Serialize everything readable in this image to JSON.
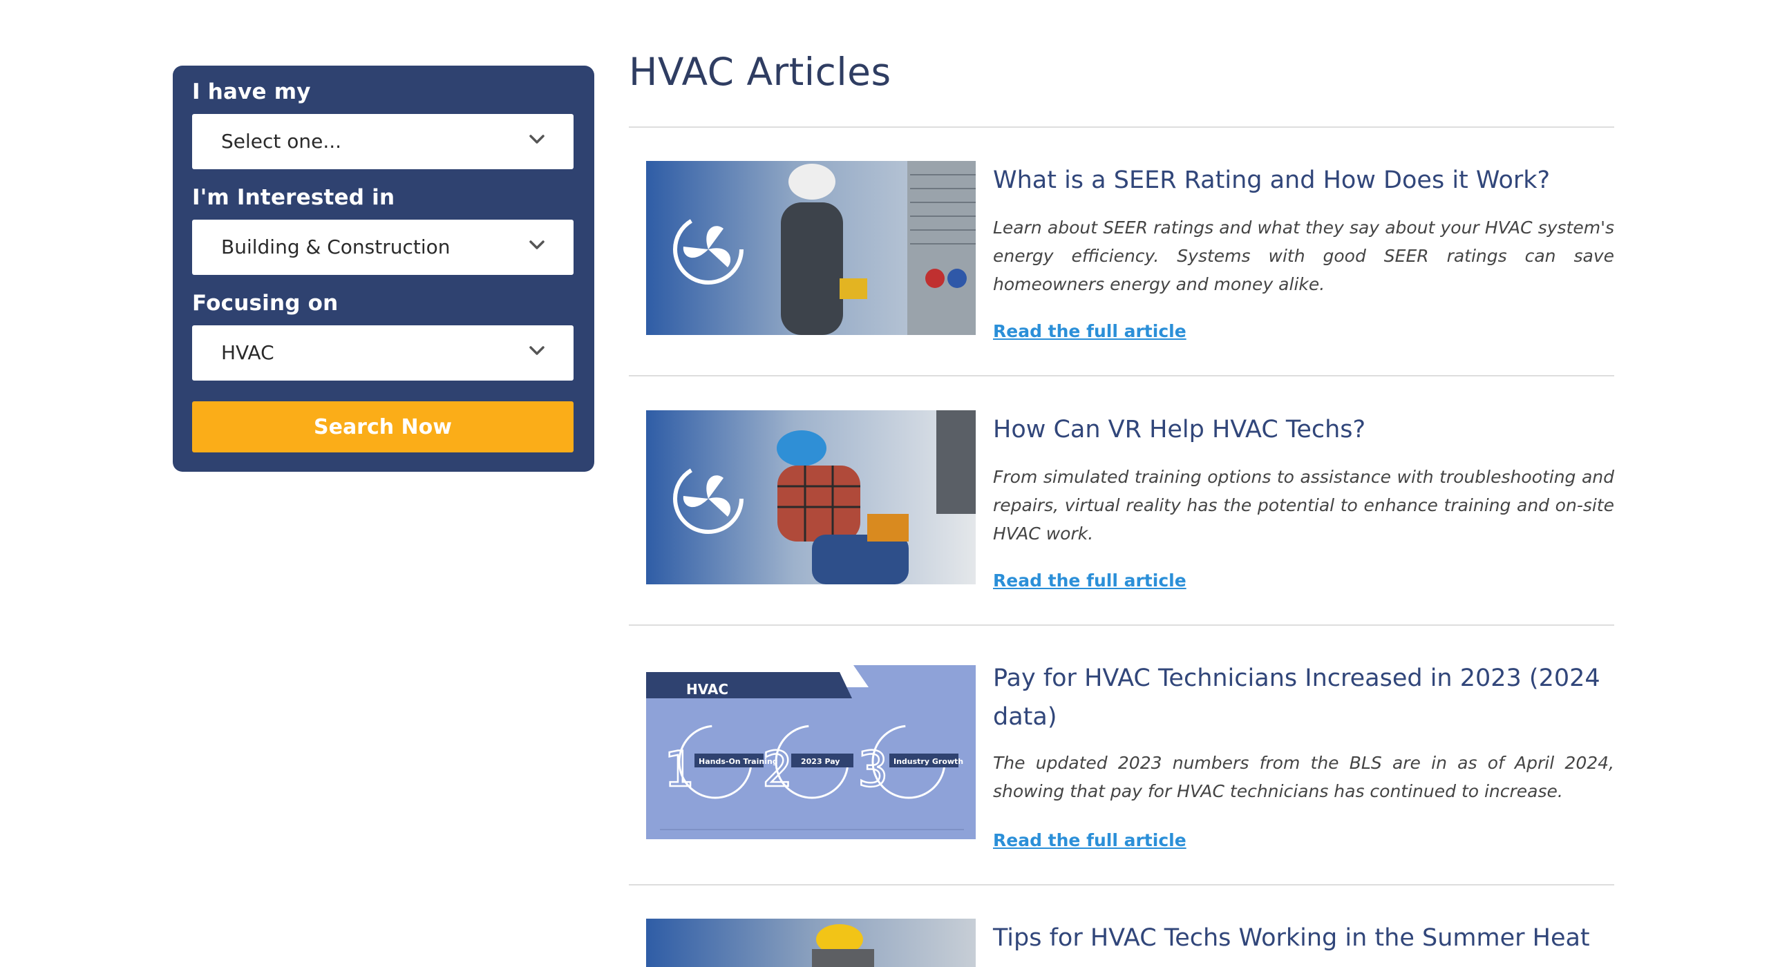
{
  "search": {
    "fields": [
      {
        "label": "I have my",
        "value": "Select one..."
      },
      {
        "label": "I'm Interested in",
        "value": "Building & Construction"
      },
      {
        "label": "Focusing on",
        "value": "HVAC"
      }
    ],
    "button_label": "Search Now"
  },
  "main": {
    "title": "HVAC Articles",
    "read_more_label": "Read the full article",
    "articles": [
      {
        "title": "What is a SEER Rating and How Does it Work?",
        "description": "Learn about SEER ratings and what they say about your HVAC system's energy efficiency. Systems with good SEER ratings can save homeowners energy and money alike."
      },
      {
        "title": "How Can VR Help HVAC Techs?",
        "description": "From simulated training options to assistance with troubleshooting and repairs, virtual reality has the potential to enhance training and on-site HVAC work."
      },
      {
        "title": "Pay for HVAC Technicians Increased in 2023 (2024 data)",
        "description": "The updated 2023 numbers from the BLS are in as of April 2024, showing that pay for HVAC technicians has continued to increase.",
        "infographic": {
          "heading": "HVAC",
          "steps": [
            {
              "number": "1",
              "label": "Hands-On Training"
            },
            {
              "number": "2",
              "label": "2023 Pay"
            },
            {
              "number": "3",
              "label": "Industry Growth"
            }
          ]
        }
      },
      {
        "title": "Tips for HVAC Techs Working in the Summer Heat"
      }
    ]
  },
  "colors": {
    "panel": "#2f4270",
    "button": "#fbad18",
    "title": "#31467a",
    "link": "#2b8fd8"
  }
}
